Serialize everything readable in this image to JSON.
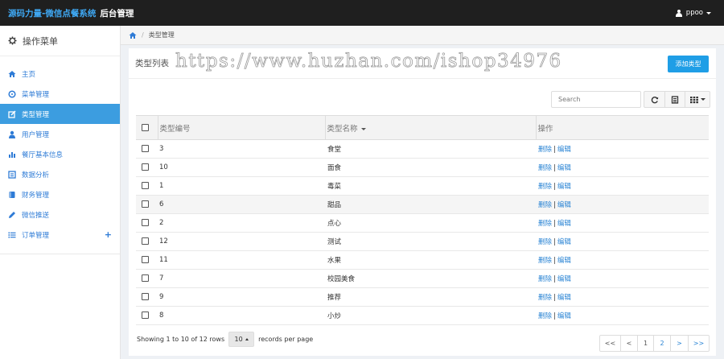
{
  "header": {
    "brand": "源码力量-微信点餐系统",
    "subtitle": "后台管理",
    "user": "ppoo"
  },
  "sidebar": {
    "title": "操作菜单",
    "items": [
      {
        "label": "主页",
        "icon": "home-icon"
      },
      {
        "label": "菜单管理",
        "icon": "circle-icon"
      },
      {
        "label": "类型管理",
        "icon": "edit-icon",
        "active": true
      },
      {
        "label": "用户管理",
        "icon": "user-icon"
      },
      {
        "label": "餐厅基本信息",
        "icon": "bar-chart-icon"
      },
      {
        "label": "数据分析",
        "icon": "list-alt-icon"
      },
      {
        "label": "财务管理",
        "icon": "book-icon"
      },
      {
        "label": "微信推送",
        "icon": "pencil-icon"
      },
      {
        "label": "订单管理",
        "icon": "list-icon",
        "expand": "+"
      }
    ]
  },
  "breadcrumb": {
    "current": "类型管理"
  },
  "panel": {
    "title": "类型列表",
    "watermark": "https://www.huzhan.com/ishop34976",
    "add_button": "添加类型"
  },
  "toolbar": {
    "search_placeholder": "Search"
  },
  "table": {
    "columns": [
      "类型编号",
      "类型名称",
      "操作"
    ],
    "rows": [
      {
        "id": "3",
        "name": "食堂"
      },
      {
        "id": "10",
        "name": "面食"
      },
      {
        "id": "1",
        "name": "毒菜"
      },
      {
        "id": "6",
        "name": "甜品"
      },
      {
        "id": "2",
        "name": "点心"
      },
      {
        "id": "12",
        "name": "测试"
      },
      {
        "id": "11",
        "name": "水果"
      },
      {
        "id": "7",
        "name": "校园美食"
      },
      {
        "id": "9",
        "name": "推荐"
      },
      {
        "id": "8",
        "name": "小炒"
      }
    ],
    "delete_label": "删除",
    "separator": "|",
    "edit_label": "编辑"
  },
  "footer": {
    "showing": "Showing 1 to 10 of 12 rows",
    "page_size": "10",
    "records_label": "records per page",
    "pager": [
      "<<",
      "<",
      "1",
      "2",
      ">",
      ">>"
    ]
  },
  "colors": {
    "topbar": "#1f1f1f",
    "brand": "#3fa9f5",
    "accent": "#3c9de0",
    "link": "#2a84d4",
    "button": "#1f9ee6"
  }
}
